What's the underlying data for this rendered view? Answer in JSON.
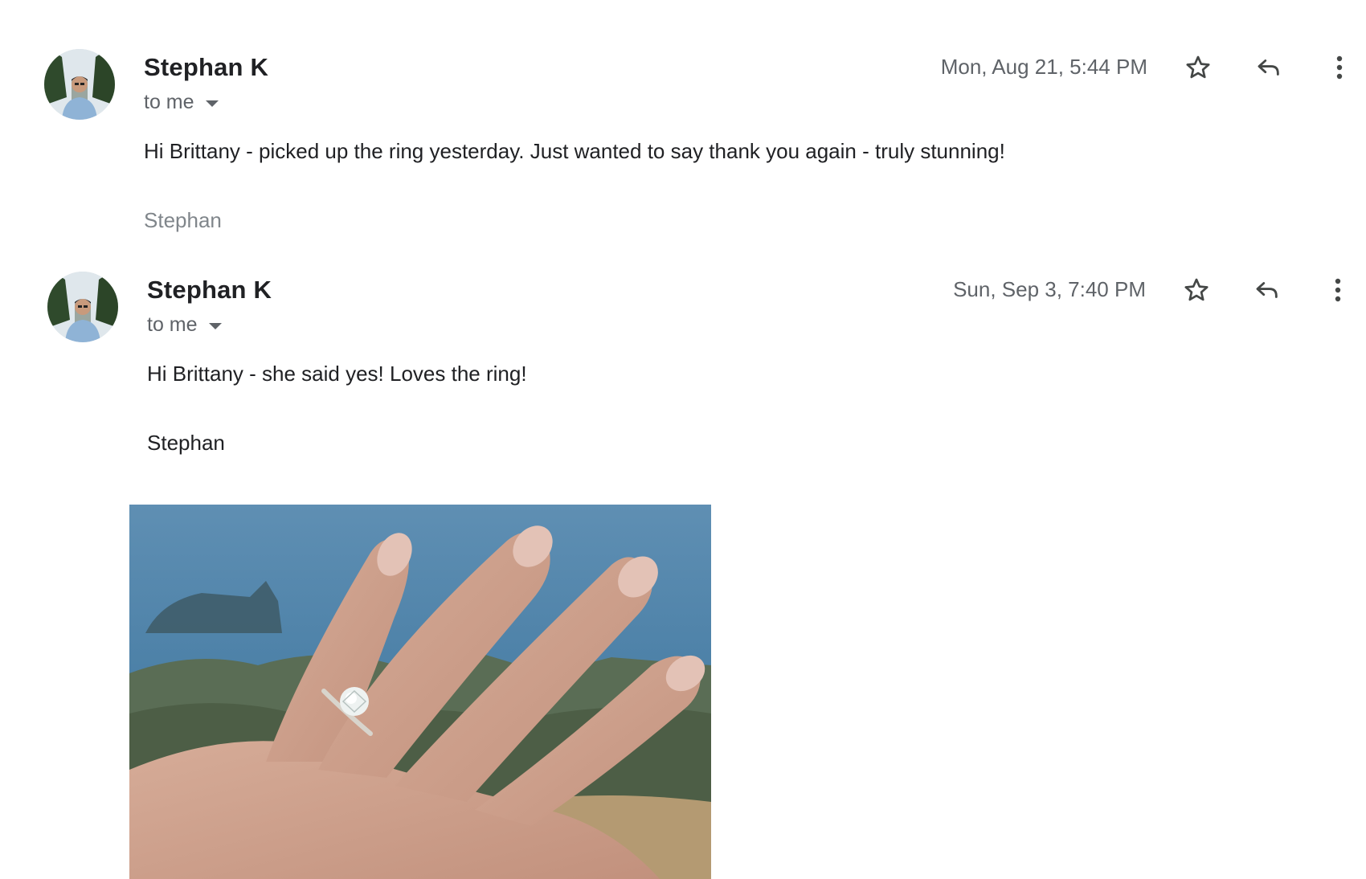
{
  "messages": [
    {
      "sender": "Stephan K",
      "recipient": "to me",
      "date": "Mon, Aug 21, 5:44 PM",
      "body": "Hi Brittany - picked up the ring yesterday. Just wanted to say thank you again - truly stunning!",
      "signature": "Stephan",
      "icons": {
        "star": "star-outline-icon",
        "reply": "reply-icon",
        "more": "more-vert-icon"
      }
    },
    {
      "sender": "Stephan K",
      "recipient": "to me",
      "date": "Sun, Sep 3, 7:40 PM",
      "body": "Hi Brittany - she said yes! Loves the ring!",
      "signature": "Stephan",
      "attachment": "hand with engagement ring photo",
      "icons": {
        "star": "star-outline-icon",
        "reply": "reply-icon",
        "more": "more-vert-icon"
      }
    }
  ],
  "colors": {
    "text": "#202124",
    "muted": "#5f6368",
    "signature_muted": "#80868b",
    "icon": "#444746"
  }
}
